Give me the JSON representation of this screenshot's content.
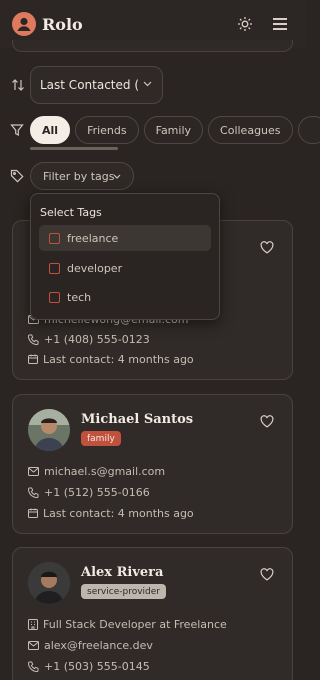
{
  "header": {
    "app_title": "Rolo",
    "theme_icon": "sun-icon",
    "menu_icon": "hamburger-menu-icon"
  },
  "sort": {
    "value": "Last Contacted (F"
  },
  "filters": {
    "chips": [
      "All",
      "Friends",
      "Family",
      "Colleagues"
    ],
    "active": "All"
  },
  "tags_filter": {
    "label": "Filter by tags"
  },
  "tags_dropdown": {
    "title": "Select Tags",
    "options": [
      "freelance",
      "developer",
      "tech"
    ]
  },
  "contacts": [
    {
      "email": "michellewong@email.com",
      "phone": "+1 (408) 555-0123",
      "last_contact": "Last contact: 4 months ago"
    },
    {
      "name": "Michael Santos",
      "badge": "family",
      "email": "michael.s@gmail.com",
      "phone": "+1 (512) 555-0166",
      "last_contact": "Last contact: 4 months ago"
    },
    {
      "name": "Alex Rivera",
      "badge": "service-provider",
      "job": "Full Stack Developer at Freelance",
      "email": "alex@freelance.dev",
      "phone": "+1 (503) 555-0145"
    }
  ],
  "colors": {
    "accent": "#e07a5f",
    "family_badge": "#c0523d",
    "background": "#2a2522"
  }
}
